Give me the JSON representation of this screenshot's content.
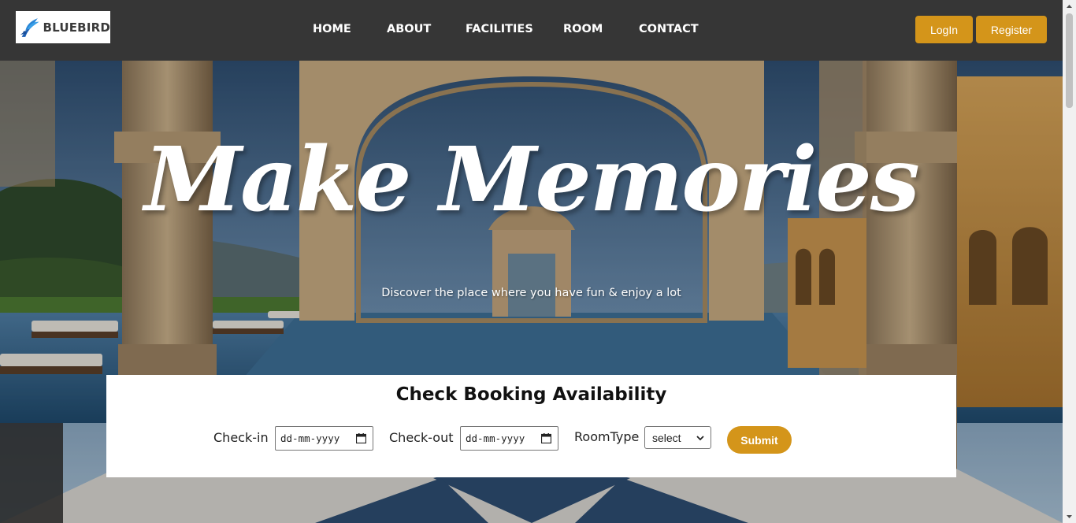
{
  "brand": {
    "name": "BLUEBIRD",
    "icon": "bird-icon"
  },
  "nav": {
    "items": [
      {
        "label": "HOME"
      },
      {
        "label": "ABOUT"
      },
      {
        "label": "FACILITIES"
      },
      {
        "label": "ROOM"
      },
      {
        "label": "CONTACT"
      }
    ]
  },
  "auth": {
    "login_label": "LogIn",
    "register_label": "Register"
  },
  "hero": {
    "title": "Make Memories",
    "subtitle": "Discover the place where you have fun & enjoy a lot"
  },
  "booking": {
    "title": "Check Booking Availability",
    "checkin_label": "Check-in",
    "checkin_placeholder": "dd-mm-yyyy",
    "checkout_label": "Check-out",
    "checkout_placeholder": "dd-mm-yyyy",
    "roomtype_label": "RoomType",
    "roomtype_selected": "select",
    "submit_label": "Submit"
  },
  "colors": {
    "accent": "#d4951a",
    "navbar": "#363636",
    "text_dark": "#111111"
  }
}
